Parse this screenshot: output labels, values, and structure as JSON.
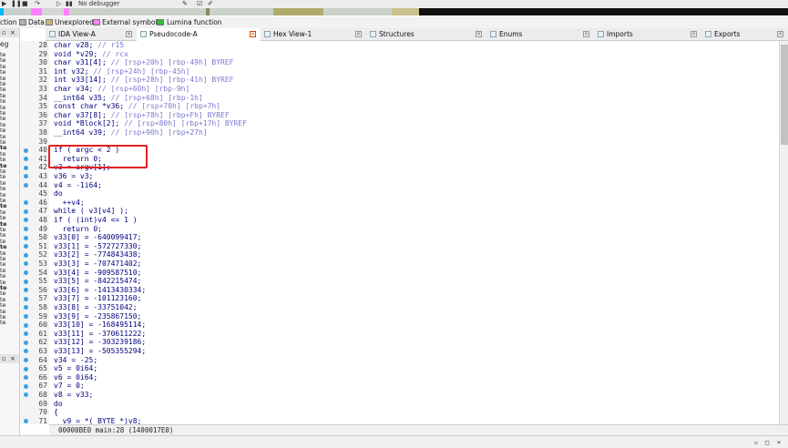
{
  "toolbar": {
    "debugger_label": "No debugger"
  },
  "nav_colors": {
    "library": "#00b8ff",
    "regular": "#9aa69b",
    "data": "#b0b87a",
    "instruction": "#a2884a",
    "external": "#ff80ff",
    "unexplored": "#c8c88c",
    "dark": "#111111"
  },
  "legend": {
    "items": [
      {
        "label": "ction",
        "color": ""
      },
      {
        "label": "Data",
        "color": "#b0b0b0"
      },
      {
        "label": "Unexplored",
        "color": "#c8b870"
      },
      {
        "label": "External symbol",
        "color": "#ff80ff"
      },
      {
        "label": "Lumina function",
        "color": "#30c030"
      }
    ]
  },
  "left_panel": {
    "header_top": "×",
    "header_mid": "×",
    "label_top": "eg",
    "items": [
      "te",
      "te",
      "te",
      "te",
      "te",
      "te",
      "te",
      "te",
      "te",
      "te",
      "te",
      "te",
      "te",
      "te",
      "te",
      "te",
      "te",
      "te",
      "te",
      "te",
      "te",
      "te",
      "te",
      "te",
      "te",
      "te",
      "te",
      "te",
      "te",
      "te",
      "te",
      "te",
      "te",
      "te",
      "te",
      "te",
      "te",
      "te",
      "te",
      "te",
      "te",
      "te",
      "te",
      "te",
      "te",
      "te",
      "te"
    ],
    "bold_items": [
      16,
      19,
      26,
      29,
      33,
      40
    ]
  },
  "tabs": [
    {
      "label": "IDA View-A",
      "active": false
    },
    {
      "label": "Pseudocode-A",
      "active": true
    },
    {
      "label": "Hex View-1",
      "active": false
    },
    {
      "label": "Structures",
      "active": false
    },
    {
      "label": "Enums",
      "active": false
    },
    {
      "label": "Imports",
      "active": false
    },
    {
      "label": "Exports",
      "active": false
    }
  ],
  "tab_close": "×",
  "code": [
    {
      "n": "28",
      "t": "char v28; ",
      "c": "// r15",
      "bp": false
    },
    {
      "n": "29",
      "t": "void *v29; ",
      "c": "// rcx",
      "bp": false
    },
    {
      "n": "30",
      "t": "char v31[4]; ",
      "c": "// [rsp+20h] [rbp-49h] BYREF",
      "bp": false
    },
    {
      "n": "31",
      "t": "int v32; ",
      "c": "// [rsp+24h] [rbp-45h]",
      "bp": false
    },
    {
      "n": "32",
      "t": "int v33[14]; ",
      "c": "// [rsp+28h] [rbp-41h] BYREF",
      "bp": false
    },
    {
      "n": "33",
      "t": "char v34; ",
      "c": "// [rsp+60h] [rbp-9h]",
      "bp": false
    },
    {
      "n": "34",
      "t": "__int64 v35; ",
      "c": "// [rsp+68h] [rbp-1h]",
      "bp": false
    },
    {
      "n": "35",
      "t": "const char *v36; ",
      "c": "// [rsp+70h] [rbp+7h]",
      "bp": false
    },
    {
      "n": "36",
      "t": "char v37[8]; ",
      "c": "// [rsp+78h] [rbp+Fh] BYREF",
      "bp": false
    },
    {
      "n": "37",
      "t": "void *Block[2]; ",
      "c": "// [rsp+80h] [rbp+17h] BYREF",
      "bp": false
    },
    {
      "n": "38",
      "t": "__int64 v39; ",
      "c": "// [rsp+90h] [rbp+27h]",
      "bp": false
    },
    {
      "n": "39",
      "t": "",
      "c": "",
      "bp": false
    },
    {
      "n": "40",
      "t": "if ( argc < 2 )",
      "c": "",
      "bp": true
    },
    {
      "n": "41",
      "t": "  return 0;",
      "c": "",
      "bp": true
    },
    {
      "n": "42",
      "t": "v3 = argv[1];",
      "c": "",
      "bp": true
    },
    {
      "n": "43",
      "t": "v36 = v3;",
      "c": "",
      "bp": true
    },
    {
      "n": "44",
      "t": "v4 = -1i64;",
      "c": "",
      "bp": true
    },
    {
      "n": "45",
      "t": "do",
      "c": "",
      "bp": false
    },
    {
      "n": "46",
      "t": "  ++v4;",
      "c": "",
      "bp": true
    },
    {
      "n": "47",
      "t": "while ( v3[v4] );",
      "c": "",
      "bp": true
    },
    {
      "n": "48",
      "t": "if ( (int)v4 <= 1 )",
      "c": "",
      "bp": true
    },
    {
      "n": "49",
      "t": "  return 0;",
      "c": "",
      "bp": true
    },
    {
      "n": "50",
      "t": "v33[0] = -640099417;",
      "c": "",
      "bp": true
    },
    {
      "n": "51",
      "t": "v33[1] = -572727330;",
      "c": "",
      "bp": true
    },
    {
      "n": "52",
      "t": "v33[2] = -774843438;",
      "c": "",
      "bp": true
    },
    {
      "n": "53",
      "t": "v33[3] = -707471402;",
      "c": "",
      "bp": true
    },
    {
      "n": "54",
      "t": "v33[4] = -909587510;",
      "c": "",
      "bp": true
    },
    {
      "n": "55",
      "t": "v33[5] = -842215474;",
      "c": "",
      "bp": true
    },
    {
      "n": "56",
      "t": "v33[6] = -1413430334;",
      "c": "",
      "bp": true
    },
    {
      "n": "57",
      "t": "v33[7] = -101123160;",
      "c": "",
      "bp": true
    },
    {
      "n": "58",
      "t": "v33[8] = -33751042;",
      "c": "",
      "bp": true
    },
    {
      "n": "59",
      "t": "v33[9] = -235867150;",
      "c": "",
      "bp": true
    },
    {
      "n": "60",
      "t": "v33[10] = -168495114;",
      "c": "",
      "bp": true
    },
    {
      "n": "61",
      "t": "v33[11] = -370611222;",
      "c": "",
      "bp": true
    },
    {
      "n": "62",
      "t": "v33[12] = -303239186;",
      "c": "",
      "bp": true
    },
    {
      "n": "63",
      "t": "v33[13] = -505355294;",
      "c": "",
      "bp": true
    },
    {
      "n": "64",
      "t": "v34 = -25;",
      "c": "",
      "bp": true
    },
    {
      "n": "65",
      "t": "v5 = 0i64;",
      "c": "",
      "bp": true
    },
    {
      "n": "66",
      "t": "v6 = 0i64;",
      "c": "",
      "bp": true
    },
    {
      "n": "67",
      "t": "v7 = 0;",
      "c": "",
      "bp": true
    },
    {
      "n": "68",
      "t": "v8 = v33;",
      "c": "",
      "bp": true
    },
    {
      "n": "69",
      "t": "do",
      "c": "",
      "bp": false
    },
    {
      "n": "70",
      "t": "{",
      "c": "",
      "bp": false
    },
    {
      "n": "71",
      "t": "  v9 = *(_BYTE *)v8;",
      "c": "",
      "bp": true
    }
  ],
  "status": {
    "text": "00000BE0 main:28 (1400017E0)"
  }
}
